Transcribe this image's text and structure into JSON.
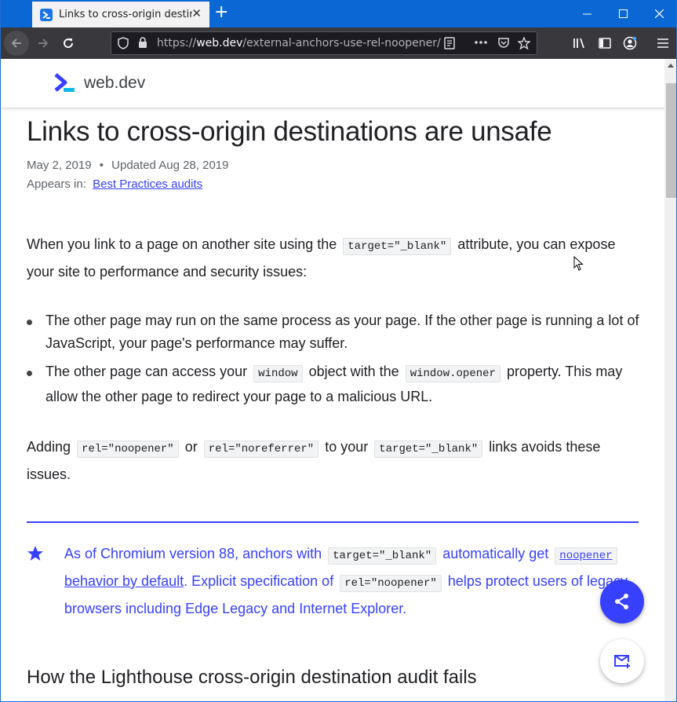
{
  "browser": {
    "tab_title": "Links to cross-origin destina",
    "tab_close": "✕",
    "new_tab": "+",
    "url_prefix": "https://",
    "url_domain": "web.dev",
    "url_path": "/external-anchors-use-rel-noopener/",
    "window_controls": {
      "minimize": "—",
      "maximize": "☐",
      "close": "✕"
    }
  },
  "site": {
    "logo_text": "web.dev"
  },
  "article": {
    "title": "Links to cross-origin destinations are unsafe",
    "date": "May 2, 2019",
    "separator": "•",
    "updated": "Updated Aug 28, 2019",
    "appears_label": "Appears in:",
    "appears_link": "Best Practices audits",
    "intro_1": "When you link to a page on another site using the",
    "intro_code": "target=\"_blank\"",
    "intro_2": "attribute, you can expose your site to performance and security issues:",
    "bullet1": "The other page may run on the same process as your page. If the other page is running a lot of JavaScript, your page's performance may suffer.",
    "bullet2_1": "The other page can access your",
    "bullet2_code1": "window",
    "bullet2_2": "object with the",
    "bullet2_code2": "window.opener",
    "bullet2_3": "property. This may allow the other page to redirect your page to a malicious URL.",
    "adding_1": "Adding",
    "adding_code1": "rel=\"noopener\"",
    "adding_2": "or",
    "adding_code2": "rel=\"noreferrer\"",
    "adding_3": "to your",
    "adding_code3": "target=\"_blank\"",
    "adding_4": "links avoids these issues.",
    "callout_1": "As of Chromium version 88, anchors with",
    "callout_code1": "target=\"_blank\"",
    "callout_2": "automatically get",
    "callout_link_code": "noopener",
    "callout_link_text": "behavior by default",
    "callout_3": ". Explicit specification of",
    "callout_code2": "rel=\"noopener\"",
    "callout_4": "helps protect users of legacy browsers including Edge Legacy and Internet Explorer.",
    "h2": "How the Lighthouse cross-origin destination audit fails"
  },
  "colors": {
    "accent": "#3740ff",
    "titlebar": "#0a67d3",
    "toolbar": "#38383d"
  }
}
